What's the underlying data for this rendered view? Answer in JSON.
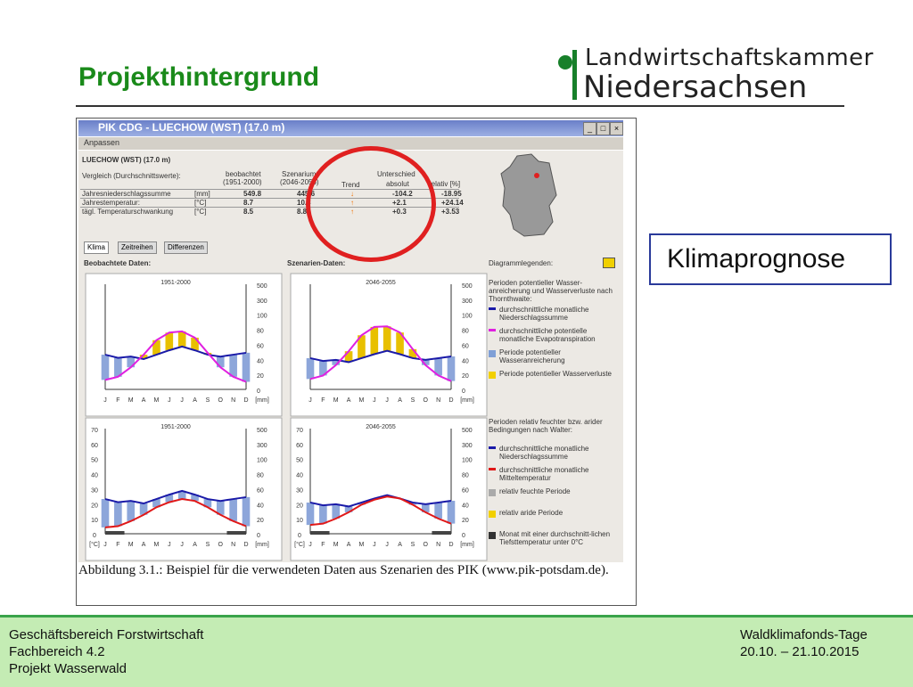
{
  "slide": {
    "title": "Projekthintergrund",
    "logo": {
      "line1": "Landwirtschaftskammer",
      "line2": "Niedersachsen"
    },
    "callout": "Klimaprognose",
    "footer": {
      "left": [
        "Geschäftsbereich Forstwirtschaft",
        "Fachbereich 4.2",
        "Projekt Wasserwald"
      ],
      "right": [
        "Waldklimafonds-Tage",
        "20.10. – 21.10.2015"
      ]
    }
  },
  "app": {
    "window_title": "PIK CDG - LUECHOW (WST) (17.0 m)",
    "menu": "Anpassen",
    "station": "LUECHOW (WST) (17.0 m)",
    "table": {
      "header_label": "Vergleich (Durchschnittswerte):",
      "col_observed": [
        "beobachtet",
        "(1951-2000)"
      ],
      "col_scenario": [
        "Szenarium",
        "(2046-2055)"
      ],
      "col_trend": "Trend",
      "col_diff": "Unterschied",
      "col_abs": "absolut",
      "col_rel": "relativ [%]",
      "rows": [
        {
          "label": "Jahresniederschlagssumme",
          "unit": "[mm]",
          "observed": "549.8",
          "scenario": "445.6",
          "trend": "down",
          "abs": "-104.2",
          "rel": "-18.95"
        },
        {
          "label": "Jahrestemperatur:",
          "unit": "[°C]",
          "observed": "8.7",
          "scenario": "10.8",
          "trend": "up",
          "abs": "+2.1",
          "rel": "+24.14"
        },
        {
          "label": "tägl. Temperaturschwankung",
          "unit": "[°C]",
          "observed": "8.5",
          "scenario": "8.8",
          "trend": "up",
          "abs": "+0.3",
          "rel": "+3.53"
        }
      ]
    },
    "tabs": [
      "Klima",
      "Zeitreihen",
      "Differenzen"
    ],
    "obs_label": "Beobachtete Daten:",
    "scen_label": "Szenarien-Daten:",
    "legend_label": "Diagrammlegenden:",
    "chart_period_obs": "1951-2000",
    "chart_period_scen": "2046-2055",
    "months": [
      "J",
      "F",
      "M",
      "A",
      "M",
      "J",
      "J",
      "A",
      "S",
      "O",
      "N",
      "D"
    ],
    "unit_mm": "[mm]",
    "unit_c": "[°C]",
    "legend_top": {
      "heading": "Perioden potentieller Wasser-anreicherung und Wasserverluste nach Thornthwaite:",
      "items": [
        "durchschnittliche monatliche Niederschlagssumme",
        "durchschnittliche potentielle monatliche Evapotranspiration",
        "Periode potentieller Wasseranreicherung",
        "Periode potentieller Wasserverluste"
      ]
    },
    "legend_bottom": {
      "heading": "Perioden relativ feuchter bzw. arider Bedingungen nach Walter:",
      "items": [
        "durchschnittliche monatliche Niederschlagssumme",
        "durchschnittliche monatliche Mitteltemperatur",
        "relativ feuchte Periode",
        "relativ aride Periode",
        "Monat mit einer durchschnitt-lichen Tiefsttemperatur unter 0°C"
      ]
    },
    "caption": "Abbildung 3.1.: Beispiel für die verwendeten Daten aus Szenarien des PIK (www.pik-potsdam.de)."
  },
  "colors": {
    "title_green": "#1a8a1a",
    "precip": "#1a1aa8",
    "pet": "#e020e0",
    "temp": "#e01818",
    "highlight": "#e02020",
    "footer_bg": "#c4ecb4"
  }
}
